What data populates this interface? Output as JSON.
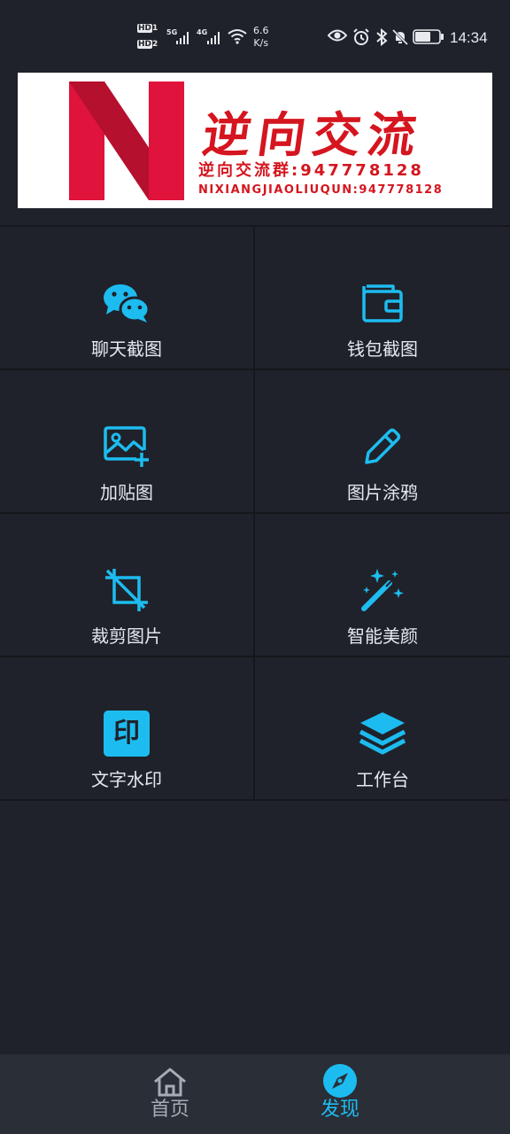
{
  "status_bar": {
    "sim1": "HD",
    "sim1_index": "1",
    "sim2": "HD",
    "sim2_index": "2",
    "net1": "5G",
    "net2": "4G",
    "speed_value": "6.6",
    "speed_unit": "K/s",
    "battery": "63",
    "time": "14:34"
  },
  "banner": {
    "title": "逆向交流",
    "line1": "逆向交流群:947778128",
    "line2": "NIXIANGJIAOLIUQUN:947778128"
  },
  "features": [
    {
      "label": "聊天截图",
      "icon": "wechat-icon"
    },
    {
      "label": "钱包截图",
      "icon": "wallet-icon"
    },
    {
      "label": "加贴图",
      "icon": "add-image-icon"
    },
    {
      "label": "图片涂鸦",
      "icon": "pencil-icon"
    },
    {
      "label": "裁剪图片",
      "icon": "crop-icon"
    },
    {
      "label": "智能美颜",
      "icon": "magic-wand-icon"
    },
    {
      "label": "文字水印",
      "icon": "watermark-icon",
      "badge": "印"
    },
    {
      "label": "工作台",
      "icon": "layers-icon"
    }
  ],
  "bottom_nav": {
    "home_label": "首页",
    "discover_label": "发现",
    "active": "discover"
  },
  "colors": {
    "accent": "#1dbcf0",
    "background": "#1f222a",
    "brand_red": "#d5151f"
  }
}
